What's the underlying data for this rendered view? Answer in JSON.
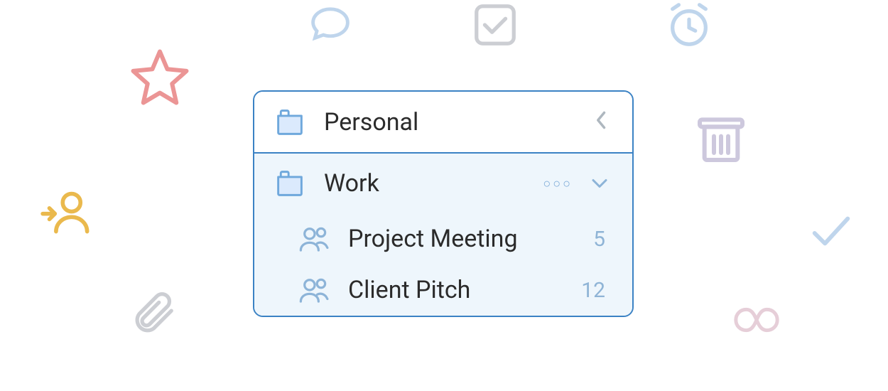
{
  "folders": {
    "personal": {
      "label": "Personal"
    },
    "work": {
      "label": "Work",
      "expanded": true,
      "children": [
        {
          "label": "Project Meeting",
          "count": "5"
        },
        {
          "label": "Client Pitch",
          "count": "12"
        }
      ]
    }
  },
  "icons": {
    "star": "star-icon",
    "chat": "chat-bubble-icon",
    "checkbox": "checkbox-icon",
    "alarm": "alarm-clock-icon",
    "user_arrow": "assign-user-icon",
    "trash": "trash-icon",
    "check": "checkmark-icon",
    "paperclip": "paperclip-icon",
    "infinity": "infinity-icon",
    "folder": "folder-icon",
    "people": "people-icon",
    "more": "more-options-icon",
    "chevron_left": "chevron-left-icon",
    "chevron_down": "chevron-down-icon"
  },
  "colors": {
    "panel_border": "#3b82c4",
    "expanded_bg": "#eef6fc",
    "star": "#e98a8a",
    "user": "#e8b23a",
    "muted_blue": "#b9d1ea",
    "muted_gray": "#c7c9cf",
    "muted_lavender": "#c8c3da",
    "folder_fill": "#dbeafd",
    "folder_stroke": "#6fa8dc",
    "count": "#8fb4d6"
  }
}
